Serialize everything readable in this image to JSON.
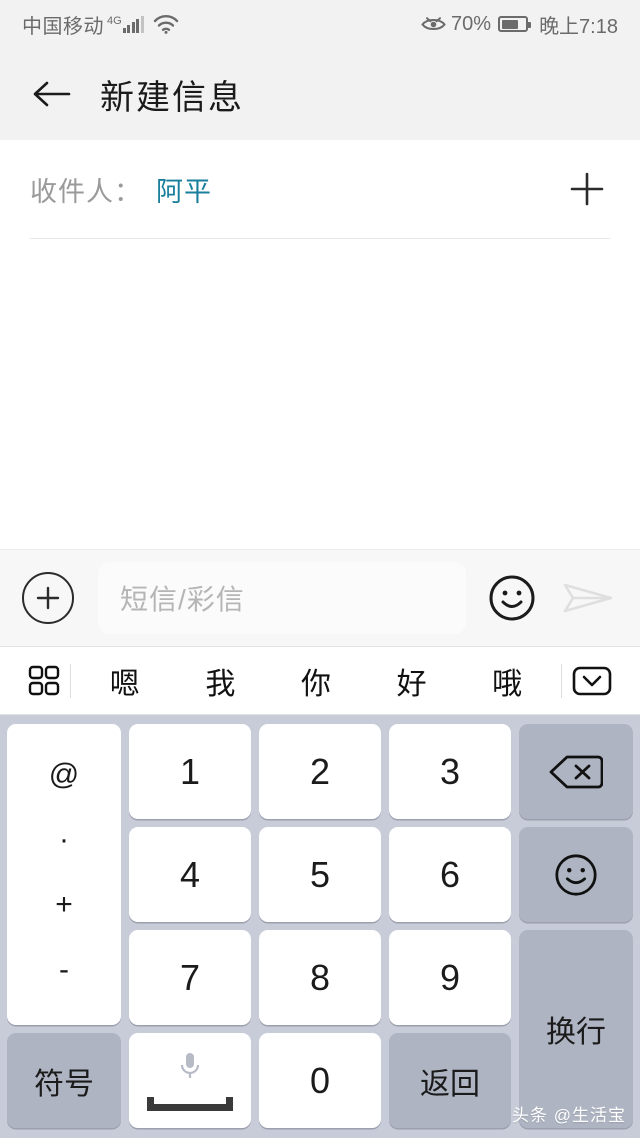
{
  "status_bar": {
    "carrier": "中国移动",
    "network_type": "4G",
    "wifi_icon": "wifi-icon",
    "eye_comfort_icon": "eye-icon",
    "battery_percent": "70%",
    "battery_level": 70,
    "clock": "晚上7:18"
  },
  "title_bar": {
    "back_icon": "back-arrow-icon",
    "title": "新建信息"
  },
  "compose": {
    "recipient_label": "收件人：",
    "recipient_value": "阿平",
    "add_recipient_icon": "plus-icon",
    "recipient_accent_color": "#1a7f9c"
  },
  "input_bar": {
    "attach_icon": "plus-circle-icon",
    "placeholder": "短信/彩信",
    "value": "",
    "emoji_icon": "smiley-icon",
    "send_icon": "send-icon"
  },
  "suggestion_bar": {
    "grid_icon": "grid-icon",
    "words": [
      "嗯",
      "我",
      "你",
      "好",
      "哦"
    ],
    "collapse_icon": "chevron-down-box-icon"
  },
  "keyboard": {
    "background_color": "#c8ccd8",
    "symbol_column": [
      "@",
      "·",
      "+",
      "-"
    ],
    "digits": [
      "1",
      "2",
      "3",
      "4",
      "5",
      "6",
      "7",
      "8",
      "9",
      "0"
    ],
    "backspace_icon": "backspace-icon",
    "emoji_key_icon": "smiley-icon",
    "newline_label": "换行",
    "symbols_label": "符号",
    "space_icon": "microphone-icon",
    "return_label": "返回"
  },
  "watermark": "头条 @生活宝"
}
